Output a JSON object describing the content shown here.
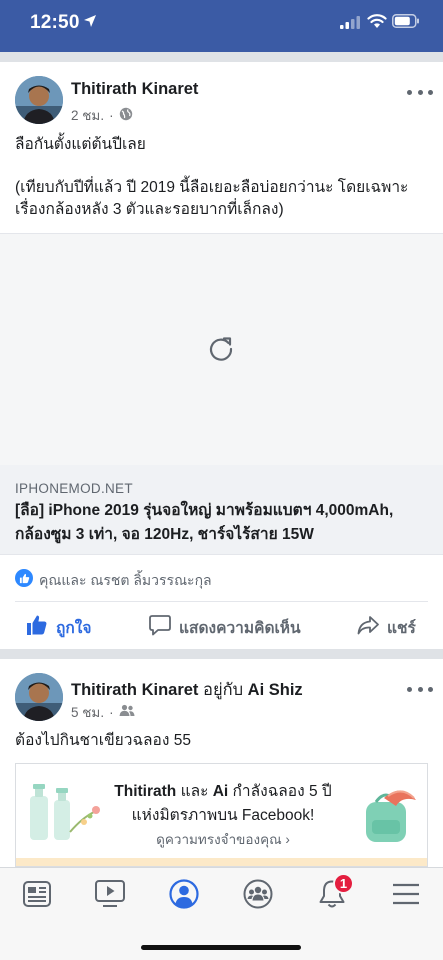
{
  "status": {
    "time": "12:50"
  },
  "post1": {
    "author": "Thitirath Kinaret",
    "time": "2 ชม.",
    "separator": "·",
    "text_line1": "ลือกันตั้งแต่ต้นปีเลย",
    "text_line2": "(เทียบกับปีที่แล้ว ปี 2019 นี้ลือเยอะลือบ่อยกว่านะ โดยเฉพาะเรื่องกล้องหลัง 3 ตัวและรอยบากที่เล็กลง)",
    "link": {
      "domain": "IPHONEMOD.NET",
      "title": "[ลือ] iPhone 2019 รุ่นจอใหญ่ มาพร้อมแบตฯ 4,000mAh, กล้องซูม 3 เท่า, จอ 120Hz, ชาร์จไร้สาย 15W"
    },
    "reactions": "คุณและ ณรชต ลิ้มวรรณะกุล",
    "actions": {
      "like": "ถูกใจ",
      "comment": "แสดงความคิดเห็น",
      "share": "แชร์"
    }
  },
  "post2": {
    "author": "Thitirath Kinaret",
    "with": "อยู่กับ",
    "with_name": "Ai Shiz",
    "time": "5 ชม.",
    "separator": "·",
    "text": "ต้องไปกินชาเขียวฉลอง 55",
    "memory": {
      "name1": "Thitirath",
      "and": "และ",
      "name2": "Ai",
      "line_rest": "กำลังฉลอง 5 ปีแห่งมิตรภาพบน Facebook!",
      "link": "ดูความทรงจำของคุณ",
      "chevron": "›"
    }
  },
  "tabbar": {
    "items": [
      "news-feed-icon",
      "watch-icon",
      "profile-icon",
      "groups-icon",
      "notifications-icon",
      "menu-icon"
    ],
    "notification_count": "1"
  },
  "colors": {
    "brand": "#3b5ba5",
    "like": "#2d6ae0",
    "badge": "#e41e3f"
  }
}
